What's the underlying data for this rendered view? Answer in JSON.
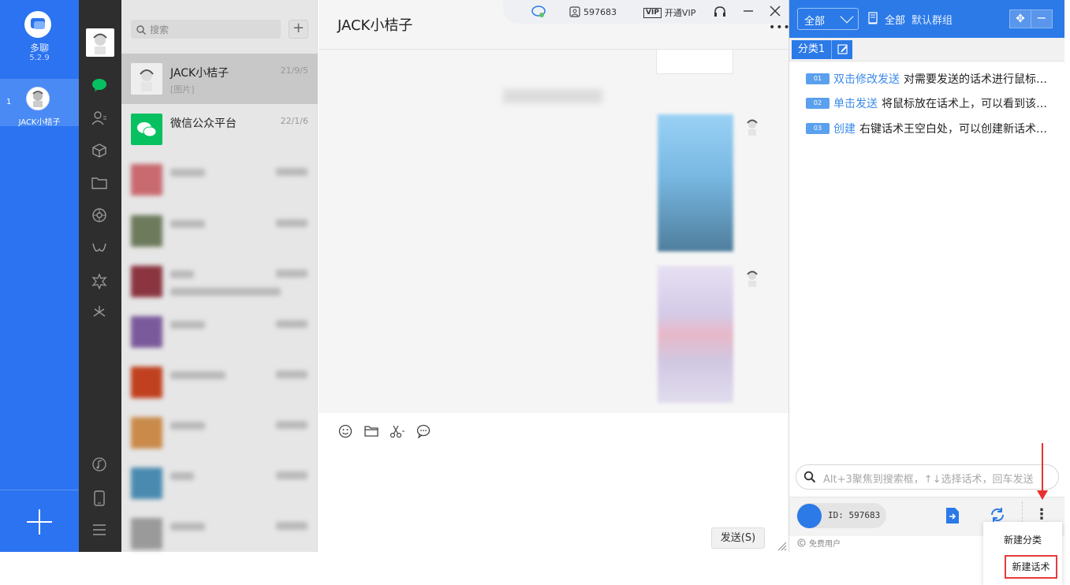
{
  "app": {
    "name": "多聊",
    "version": "5.2.9",
    "account_index": "1",
    "account_name": "JACK小桔子"
  },
  "chat_list": {
    "search_placeholder": "搜索",
    "items": [
      {
        "name": "JACK小桔子",
        "preview": "[图片]",
        "date": "21/9/5"
      },
      {
        "name": "微信公众平台",
        "preview": "",
        "date": "22/1/6"
      }
    ]
  },
  "chat": {
    "title": "JACK小桔子",
    "send_label": "发送(S)"
  },
  "titlebar": {
    "user_id": "597683",
    "vip_label": "开通VIP",
    "vip_badge": "VIP"
  },
  "panel": {
    "filter_value": "全部",
    "group_all": "全部",
    "group_default": "默认群组",
    "category_tab": "分类1",
    "scripts": [
      {
        "num": "01",
        "key": "双击修改发送",
        "desc": "对需要发送的话术进行鼠标…"
      },
      {
        "num": "02",
        "key": "单击发送",
        "desc": "将鼠标放在话术上，可以看到该…"
      },
      {
        "num": "03",
        "key": "创建",
        "desc": "右键话术王空白处，可以创建新话术…"
      }
    ],
    "search_placeholder": "Alt+3聚焦到搜索框，↑↓选择话术，回车发送",
    "user_id_label": "ID: 597683",
    "free_user": "免费用户",
    "menu": {
      "new_category": "新建分类",
      "new_script": "新建话术"
    }
  },
  "colors": {
    "brand_blue": "#2b73f0",
    "panel_blue": "#2b7ae8",
    "wechat_green": "#07c160",
    "highlight_red": "#e53b3b"
  }
}
